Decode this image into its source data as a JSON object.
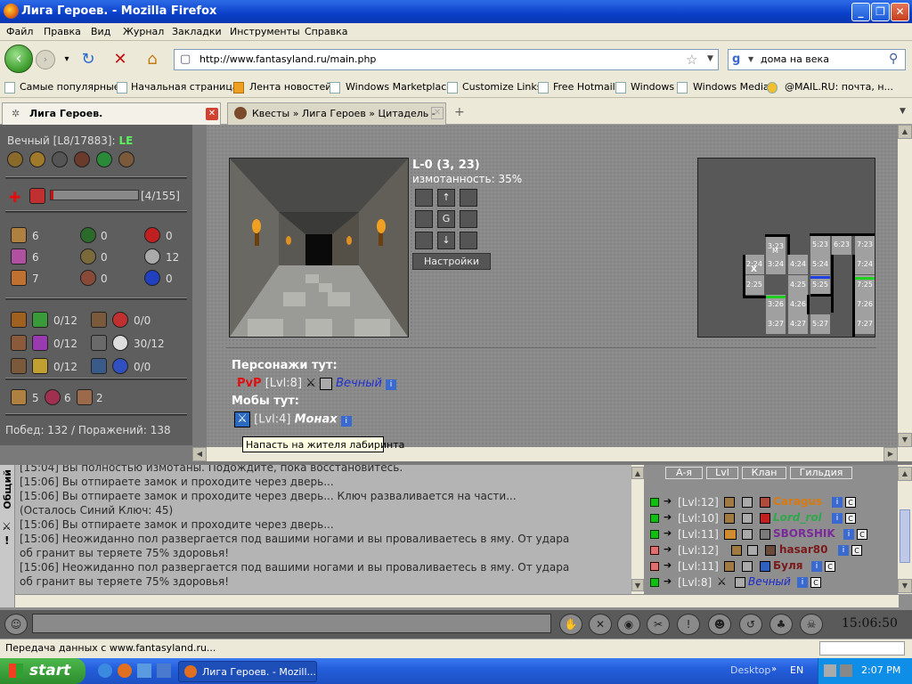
{
  "window": {
    "title": "Лига Героев. - Mozilla Firefox"
  },
  "menu": [
    "Файл",
    "Правка",
    "Вид",
    "Журнал",
    "Закладки",
    "Инструменты",
    "Справка"
  ],
  "nav": {
    "url": "http://www.fantasyland.ru/main.php",
    "search_value": "дома на века"
  },
  "bookmarks": [
    "Самые популярные",
    "Начальная страница",
    "Лента новостей",
    "Windows Marketplace",
    "Customize Links",
    "Free Hotmail",
    "Windows",
    "Windows Media",
    "@MAIL.RU: почта, н..."
  ],
  "tabs": [
    {
      "label": "Лига Героев."
    },
    {
      "label": "Квесты » Лига Героев » Цитадель - ..."
    }
  ],
  "character": {
    "name": "Вечный",
    "level_info": "[L8/17883]:",
    "tag": "LE",
    "hp_text": "[4/155]",
    "stats": [
      {
        "left": "6",
        "mid": "0",
        "right": "0"
      },
      {
        "left": "6",
        "mid": "0",
        "right": "12"
      },
      {
        "left": "7",
        "mid": "0",
        "right": "0"
      }
    ],
    "ammo": [
      {
        "a": "0/12",
        "b": "0/0"
      },
      {
        "a": "0/12",
        "b": "30/12"
      },
      {
        "a": "0/12",
        "b": "0/0"
      }
    ],
    "items": [
      "5",
      "6",
      "2"
    ],
    "record": "Побед: 132 / Поражений: 138"
  },
  "location": {
    "coords": "L-0 (3, 23)",
    "fatigue": "измотанность: 35%",
    "center_label": "G",
    "settings_label": "Настройки",
    "characters_header": "Персонажи тут:",
    "pvp_label": "PvP",
    "pvp_level": "[Lvl:8]",
    "pvp_name": "Вечный",
    "mobs_header": "Мобы тут:",
    "mob_level": "[Lvl:4]",
    "mob_name": "Монах",
    "tooltip": "Напасть на жителя лабиринта"
  },
  "minimap": {
    "cells": [
      {
        "t": "3:23",
        "sub": "M"
      },
      {
        "t": "5:23"
      },
      {
        "t": "6:23"
      },
      {
        "t": "7:23"
      },
      {
        "t": "2:24",
        "sub": "X"
      },
      {
        "t": "3:24"
      },
      {
        "t": "4:24"
      },
      {
        "t": "5:24"
      },
      {
        "t": "7:24"
      },
      {
        "t": "2:25"
      },
      {
        "t": "4:25"
      },
      {
        "t": "5:25"
      },
      {
        "t": "7:25"
      },
      {
        "t": "3:26"
      },
      {
        "t": "4:26"
      },
      {
        "t": "7:26"
      },
      {
        "t": "3:27"
      },
      {
        "t": "4:27"
      },
      {
        "t": "5:27"
      },
      {
        "t": "7:27"
      }
    ]
  },
  "chat": {
    "tab_label": "Общий",
    "lines": [
      "[15:04] Вы полностью измотаны. Подождите, пока восстановитесь.",
      "[15:06] Вы отпираете замок и проходите через дверь...",
      "[15:06] Вы отпираете замок и проходите через дверь... Ключ разваливается на части...",
      "(Осталось Синий Ключ: 45)",
      "[15:06] Вы отпираете замок и проходите через дверь...",
      "[15:06] Неожиданно пол развергается под вашими ногами и вы проваливаетесь в яму. От удара",
      "об гранит вы теряете 75% здоровья!",
      "[15:06] Неожиданно пол развергается под вашими ногами и вы проваливаетесь в яму. От удара",
      "об гранит вы теряете 75% здоровья!"
    ]
  },
  "players": {
    "headers": [
      "А-я",
      "Lvl",
      "Клан",
      "Гильдия"
    ],
    "rows": [
      {
        "lvl": "[Lvl:12]",
        "name": "Caragus",
        "color": "#d97a10"
      },
      {
        "lvl": "[Lvl:10]",
        "name": "Lord_rol",
        "color": "#2fa84a"
      },
      {
        "lvl": "[Lvl:11]",
        "name": "SBORSHIK",
        "color": "#7a2a9a"
      },
      {
        "lvl": "[Lvl:12]",
        "name": "hasar80",
        "color": "#7a1a1a"
      },
      {
        "lvl": "[Lvl:11]",
        "name": "Буля",
        "color": "#7a1a1a"
      },
      {
        "lvl": "[Lvl:8]",
        "name": "Вечный",
        "color": "#1a2ad0"
      }
    ],
    "info_icon": "i",
    "c_icon": "C"
  },
  "clock": "15:06:50",
  "status": "Передача данных с www.fantasyland.ru...",
  "taskbar": {
    "start": "start",
    "item": "Лига Героев. - Mozill...",
    "desktop": "Desktop",
    "lang": "EN",
    "time": "2:07 PM"
  }
}
